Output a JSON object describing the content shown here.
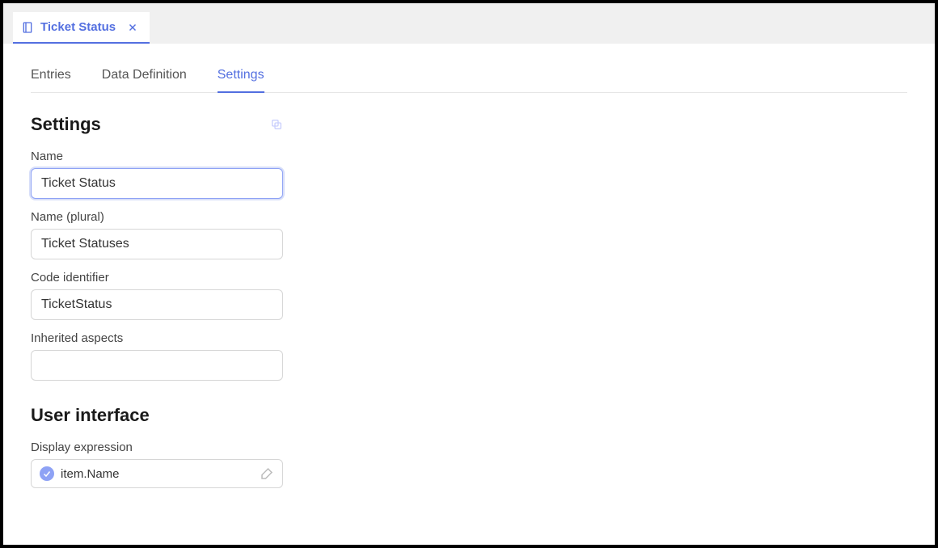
{
  "tab": {
    "title": "Ticket Status"
  },
  "subtabs": {
    "entries": "Entries",
    "dataDefinition": "Data Definition",
    "settings": "Settings"
  },
  "sections": {
    "settingsTitle": "Settings",
    "uiTitle": "User interface"
  },
  "fields": {
    "name": {
      "label": "Name",
      "value": "Ticket Status"
    },
    "namePlural": {
      "label": "Name (plural)",
      "value": "Ticket Statuses"
    },
    "codeId": {
      "label": "Code identifier",
      "value": "TicketStatus"
    },
    "inherited": {
      "label": "Inherited aspects",
      "value": ""
    },
    "displayExpr": {
      "label": "Display expression",
      "value": "item.Name"
    }
  }
}
